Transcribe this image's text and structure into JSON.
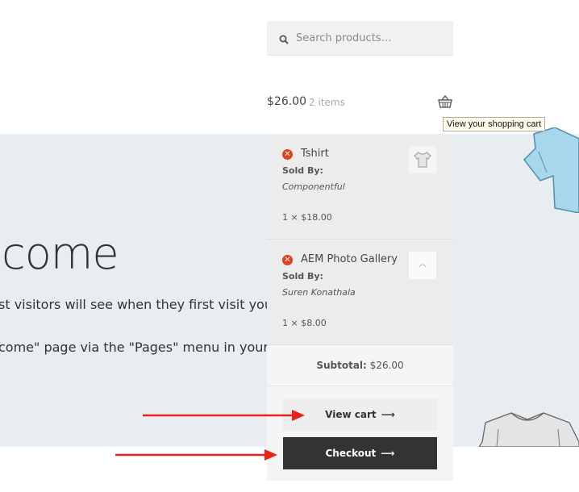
{
  "search": {
    "placeholder": "Search products…"
  },
  "cart": {
    "amount": "$26.00",
    "count": "2 items",
    "tooltip": "View your shopping cart"
  },
  "hero": {
    "title": "lcome",
    "line1": "st visitors will see when they first visit your sh",
    "line2": "come\" page via the \"Pages\" menu in your dash"
  },
  "mini_cart": {
    "items": [
      {
        "name": "Tshirt",
        "sold_by_label": "Sold By:",
        "vendor": "Componentful",
        "qty_price": "1 × $18.00",
        "remove_icon": "remove-icon",
        "thumbnail_icon": "tshirt-thumbnail"
      },
      {
        "name": "AEM Photo Gallery",
        "sold_by_label": "Sold By:",
        "vendor": "Suren Konathala",
        "qty_price": "1 × $8.00",
        "remove_icon": "remove-icon",
        "thumbnail_icon": "gallery-thumbnail"
      }
    ],
    "subtotal_label": "Subtotal:",
    "subtotal_value": "$26.00",
    "view_cart_label": "View cart",
    "checkout_label": "Checkout",
    "arrow_glyph": "⟶"
  },
  "colors": {
    "remove": "#e2401c",
    "checkout_bg": "#333333",
    "annotation_arrow": "#e8231a",
    "hero_bg": "#e8edf1"
  }
}
